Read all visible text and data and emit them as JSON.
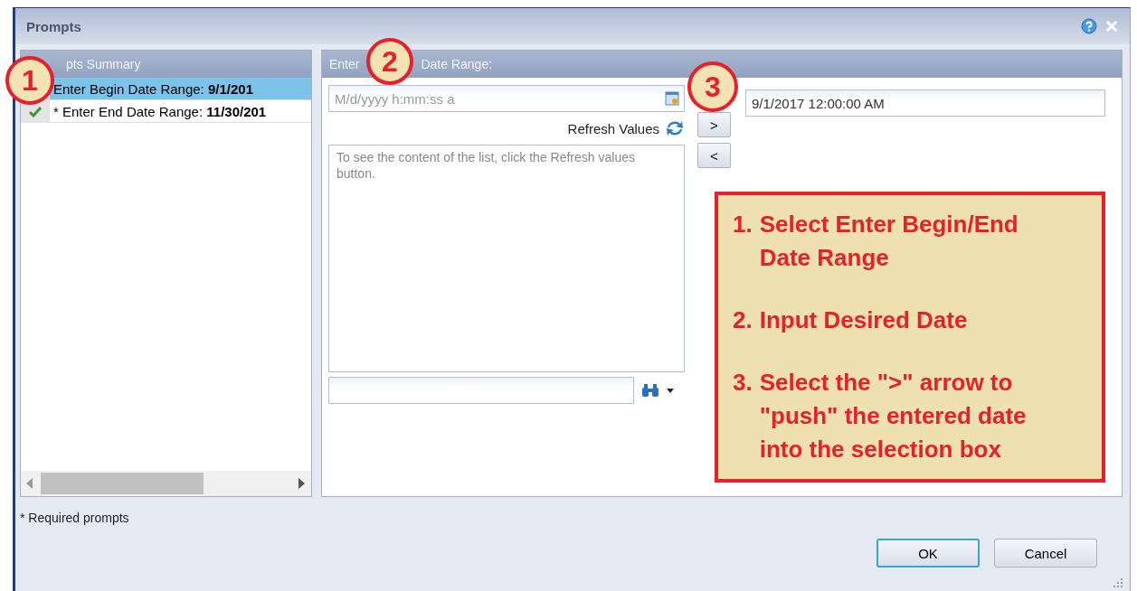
{
  "window": {
    "title": "Prompts"
  },
  "summary": {
    "header": "pts Summary",
    "items": [
      {
        "label": "Enter Begin Date Range: ",
        "value": "9/1/201",
        "selected": true
      },
      {
        "label": "* Enter End Date Range: ",
        "value": "11/30/201",
        "selected": false,
        "checked": true
      }
    ]
  },
  "prompt": {
    "header_start": "Enter",
    "header_end": "Date Range:",
    "date_field": {
      "placeholder": "M/d/yyyy h:mm:ss a"
    },
    "refresh": "Refresh Values",
    "list_hint": "To see the content of the list, click the Refresh values button.",
    "add_button": ">",
    "remove_button": "<",
    "selected_value": "9/1/2017 12:00:00 AM"
  },
  "callout": {
    "steps": [
      {
        "number": "1.",
        "text": "Select Enter Begin/End Date Range"
      },
      {
        "number": "2.",
        "text": "Input Desired Date"
      },
      {
        "number": "3.",
        "text": "Select the \">\" arrow to \"push\" the entered date into the selection box"
      }
    ]
  },
  "markers": [
    "1",
    "2",
    "3"
  ],
  "footer": {
    "note": "* Required prompts",
    "buttons": [
      "OK",
      "Cancel"
    ]
  }
}
